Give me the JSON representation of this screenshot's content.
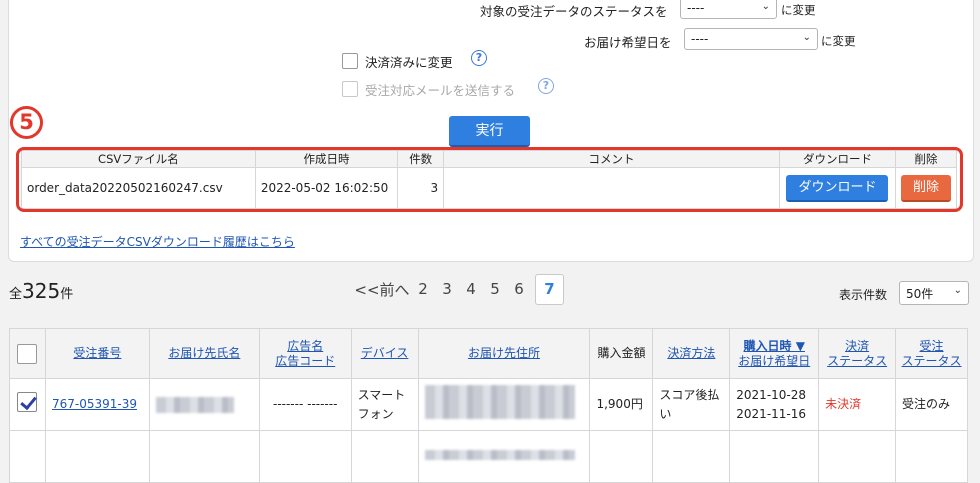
{
  "status_change": {
    "label": "対象の受注データのステータスを",
    "select_value": "----",
    "suffix": "に変更"
  },
  "delivery_change": {
    "label": "お届け希望日を",
    "select_value": "----",
    "suffix": "に変更"
  },
  "options": {
    "paid_label": "決済済みに変更",
    "mail_label": "受注対応メールを送信する",
    "help_symbol": "?"
  },
  "step_number": "5",
  "execute_label": "実行",
  "csv_table": {
    "headers": [
      "CSVファイル名",
      "作成日時",
      "件数",
      "コメント",
      "ダウンロード",
      "削除"
    ],
    "row": {
      "filename": "order_data20220502160247.csv",
      "created_at": "2022-05-02 16:02:50",
      "count": "3",
      "comment": "",
      "download_label": "ダウンロード",
      "delete_label": "削除"
    }
  },
  "history_link": "すべての受注データCSVダウンロード履歴はこちら",
  "total": {
    "prefix": "全",
    "count": "325",
    "suffix": "件"
  },
  "pager": {
    "prev": "<<前へ",
    "pages": [
      "2",
      "3",
      "4",
      "5",
      "6"
    ],
    "current": "7"
  },
  "per_page": {
    "label": "表示件数",
    "value": "50件"
  },
  "orders_table": {
    "headers": {
      "order_no": "受注番号",
      "recipient": "お届け先氏名",
      "ad_name": "広告名",
      "ad_code": "広告コード",
      "device": "デバイス",
      "address": "お届け先住所",
      "amount": "購入金額",
      "payment": "決済方法",
      "purchase_date": "購入日時 ▼",
      "delivery_date": "お届け希望日",
      "pay_status_1": "決済",
      "pay_status_2": "ステータス",
      "order_status_1": "受注",
      "order_status_2": "ステータス"
    },
    "rows": [
      {
        "checked": true,
        "order_no": "767-05391-39",
        "ad": "------- -------",
        "device_1": "スマート",
        "device_2": "フォン",
        "amount": "1,900円",
        "payment": "スコア後払い",
        "purchase_date": "2021-10-28",
        "delivery_date": "2021-11-16",
        "pay_status": "未決済",
        "order_status": "受注のみ"
      }
    ]
  },
  "colors": {
    "accent": "#2f7fe0",
    "highlight": "#e2372a",
    "delete": "#e8683f",
    "link": "#1f55b3"
  }
}
